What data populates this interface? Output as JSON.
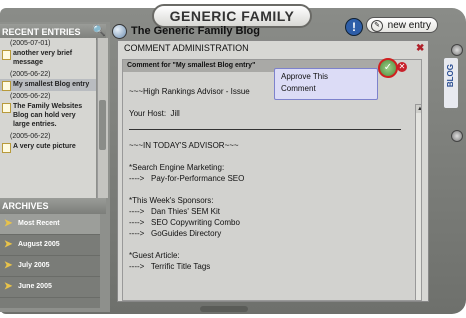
{
  "app": {
    "title": "GENERIC FAMILY"
  },
  "sidebar": {
    "recent_heading": "RECENT ENTRIES",
    "search_icon": "search-icon",
    "entries": [
      {
        "date": "(2005-07-01)",
        "title": "another very brief message"
      },
      {
        "date": "(2005-06-22)",
        "title": "My smallest Blog entry",
        "selected": true
      },
      {
        "date": "(2005-06-22)",
        "title": "The Family Websites Blog can hold very large entries."
      },
      {
        "date": "(2005-06-22)",
        "title": "A very cute picture"
      }
    ],
    "archives_heading": "ARCHIVES",
    "archives": [
      {
        "label": "Most Recent",
        "selected": true
      },
      {
        "label": "August 2005"
      },
      {
        "label": "July 2005"
      },
      {
        "label": "June 2005"
      }
    ]
  },
  "header": {
    "blog_title": "The Generic Family Blog",
    "info_label": "!",
    "new_entry_label": "new entry"
  },
  "admin": {
    "title": "COMMENT ADMINISTRATION",
    "comment_heading": "Comment for \"My smallest Blog entry\"",
    "approve_tooltip_line1": "Approve This",
    "approve_tooltip_line2": "Comment",
    "body": {
      "l1": "~~~High Rankings Advisor - Issue",
      "l2": "Your Host:  Jill",
      "l3": "~~~IN TODAY'S ADVISOR~~~",
      "l4": "*Search Engine Marketing:",
      "l5": "---->   Pay-for-Performance SEO",
      "l6": "*This Week's Sponsors:",
      "l7": "---->   Dan Thies' SEM Kit",
      "l8": "---->   SEO Copywriting Combo",
      "l9": "---->   GoGuides Directory",
      "l10": "*Guest Article:",
      "l11": "---->   Terrific Title Tags"
    }
  },
  "right_tab": {
    "label": "BLOG"
  }
}
